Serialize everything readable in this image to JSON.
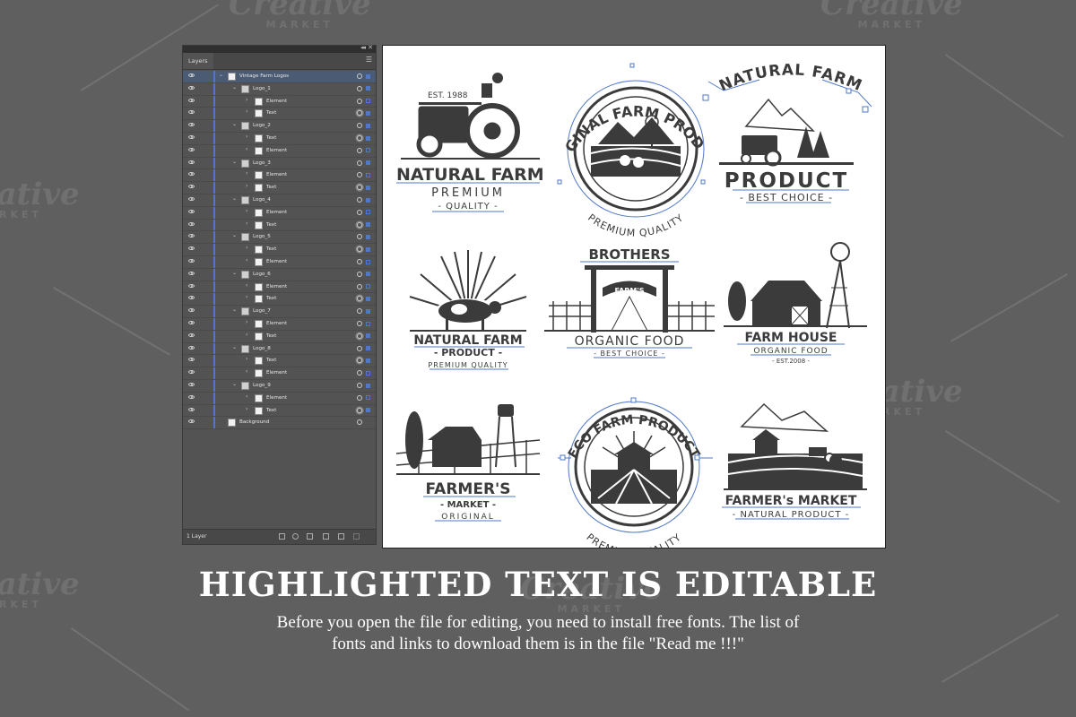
{
  "watermark": {
    "word": "Creative",
    "sub": "MARKET"
  },
  "layers_panel": {
    "tab_label": "Layers",
    "footer_count": "1 Layer",
    "rows": [
      {
        "name": "Vintage Farm Logos",
        "level": 0,
        "selected": true
      },
      {
        "name": "Logo_1",
        "level": 1
      },
      {
        "name": "Element",
        "level": 2
      },
      {
        "name": "Text",
        "level": 2
      },
      {
        "name": "Logo_2",
        "level": 1
      },
      {
        "name": "Text",
        "level": 2
      },
      {
        "name": "Element",
        "level": 2
      },
      {
        "name": "Logo_3",
        "level": 1
      },
      {
        "name": "Element",
        "level": 2
      },
      {
        "name": "Text",
        "level": 2
      },
      {
        "name": "Logo_4",
        "level": 1
      },
      {
        "name": "Element",
        "level": 2
      },
      {
        "name": "Text",
        "level": 2
      },
      {
        "name": "Logo_5",
        "level": 1
      },
      {
        "name": "Text",
        "level": 2
      },
      {
        "name": "Element",
        "level": 2
      },
      {
        "name": "Logo_6",
        "level": 1
      },
      {
        "name": "Element",
        "level": 2
      },
      {
        "name": "Text",
        "level": 2
      },
      {
        "name": "Logo_7",
        "level": 1
      },
      {
        "name": "Element",
        "level": 2
      },
      {
        "name": "Text",
        "level": 2
      },
      {
        "name": "Logo_8",
        "level": 1
      },
      {
        "name": "Text",
        "level": 2
      },
      {
        "name": "Element",
        "level": 2
      },
      {
        "name": "Logo_9",
        "level": 1
      },
      {
        "name": "Element",
        "level": 2
      },
      {
        "name": "Text",
        "level": 2
      },
      {
        "name": "Background",
        "level": 0
      }
    ]
  },
  "logos": {
    "logo1": {
      "est": "EST. 1988",
      "title": "NATURAL FARM",
      "sub": "PREMIUM",
      "tag": "- QUALITY -"
    },
    "logo2": {
      "arc_top": "ORIGINAL FARM PRODUCT",
      "arc_bottom": "PREMIUM QUALITY"
    },
    "logo3": {
      "arc_top": "NATURAL FARM",
      "title": "PRODUCT",
      "tag": "- BEST CHOICE -"
    },
    "logo4": {
      "title": "NATURAL FARM",
      "sub": "- PRODUCT -",
      "tag": "PREMIUM QUALITY"
    },
    "logo5": {
      "top": "BROTHERS",
      "ribbon": "FARM'S",
      "title": "ORGANIC FOOD",
      "tag": "- BEST CHOICE -"
    },
    "logo6": {
      "title": "FARM HOUSE",
      "sub": "ORGANIC FOOD",
      "tag": "- EST.2008 -"
    },
    "logo7": {
      "title": "FARMER'S",
      "sub": "- MARKET -",
      "tag": "ORIGINAL"
    },
    "logo8": {
      "arc_top": "ECO FARM PRODUCT",
      "arc_bottom": "PREMIUM QUALITY"
    },
    "logo9": {
      "title": "FARMER's MARKET",
      "tag": "- NATURAL PRODUCT -"
    }
  },
  "headline": "HIGHLIGHTED TEXT IS EDITABLE",
  "subtext": "Before you open the file for editing, you need to install free fonts. The list of fonts and links to download them is in the file \"Read me !!!\"",
  "colors": {
    "background": "#5f5f5f",
    "panel": "#535353",
    "selection_blue": "#4f78c8",
    "logo_ink": "#3b3b3b",
    "artboard": "#ffffff"
  }
}
